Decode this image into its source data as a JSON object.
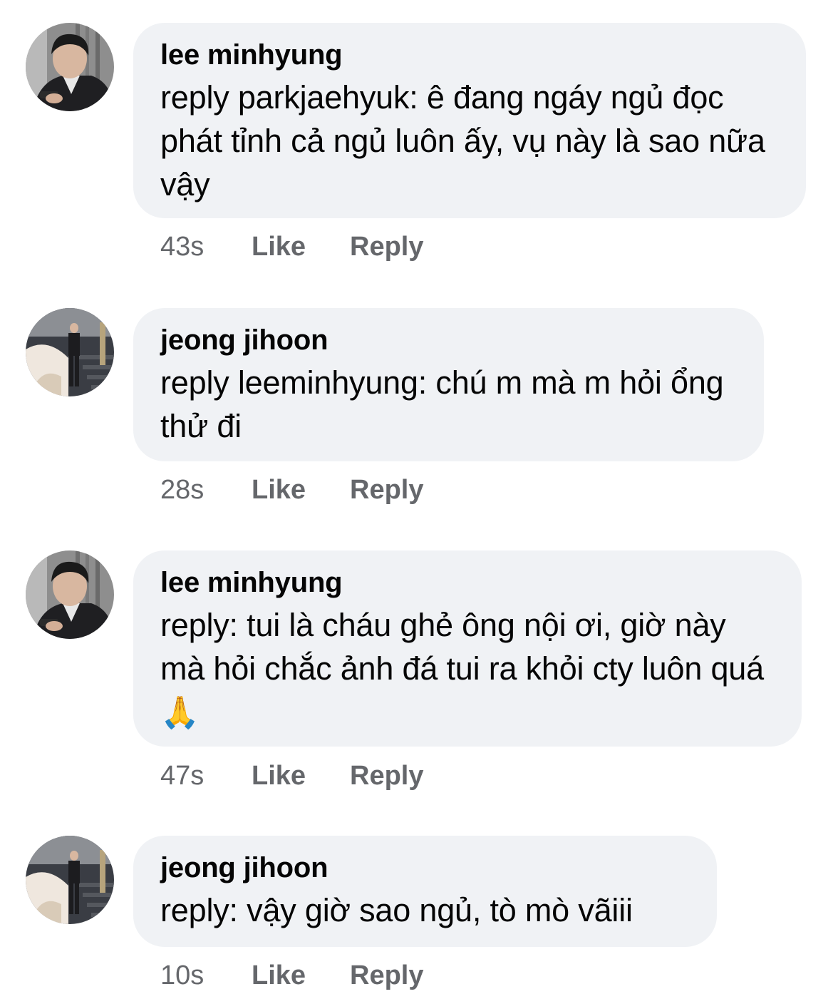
{
  "comments": [
    {
      "author": "lee minhyung",
      "avatar_icon": "profile-photo-man-in-suit-with-phone",
      "text": "reply parkjaehyuk: ê đang ngáy ngủ đọc phát tỉnh cả ngủ luôn ấy, vụ này là sao nữa vậy",
      "time": "43s",
      "like_label": "Like",
      "reply_label": "Reply"
    },
    {
      "author": "jeong jihoon",
      "avatar_icon": "profile-photo-man-on-stairs",
      "text": "reply leeminhyung: chú m mà m hỏi ổng thử đi",
      "time": "28s",
      "like_label": "Like",
      "reply_label": "Reply"
    },
    {
      "author": "lee minhyung",
      "avatar_icon": "profile-photo-man-in-suit-with-phone",
      "text": "reply: tui là cháu ghẻ ông nội ơi, giờ này mà hỏi chắc ảnh đá tui ra khỏi cty luôn quá",
      "emoji": "🙏",
      "time": "47s",
      "like_label": "Like",
      "reply_label": "Reply"
    },
    {
      "author": "jeong jihoon",
      "avatar_icon": "profile-photo-man-on-stairs",
      "text": "reply: vậy giờ sao ngủ, tò mò vãiii",
      "time": "10s",
      "like_label": "Like",
      "reply_label": "Reply"
    }
  ]
}
